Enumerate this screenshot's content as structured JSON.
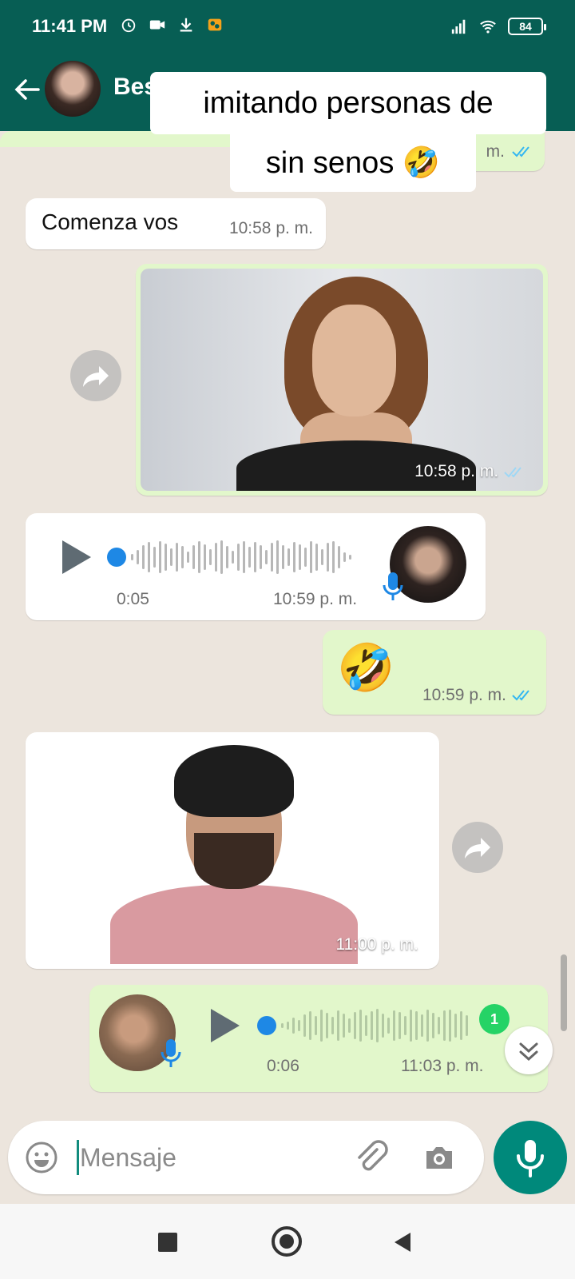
{
  "status_bar": {
    "time": "11:41 PM",
    "battery": "84"
  },
  "header": {
    "contact_name": "Bes"
  },
  "caption": {
    "line1": "imitando personas de",
    "line2": "sin senos 🤣"
  },
  "messages": [
    {
      "id": "partial",
      "direction": "out",
      "time": "m."
    },
    {
      "id": "text1",
      "direction": "in",
      "text": "Comenza vos",
      "time": "10:58 p. m."
    },
    {
      "id": "image1",
      "direction": "out",
      "time": "10:58 p. m."
    },
    {
      "id": "voice1",
      "direction": "in",
      "duration": "0:05",
      "time": "10:59 p. m."
    },
    {
      "id": "emoji1",
      "direction": "out",
      "text": "🤣",
      "time": "10:59 p. m."
    },
    {
      "id": "image2",
      "direction": "in",
      "time": "11:00 p. m."
    },
    {
      "id": "voice2",
      "direction": "out",
      "duration": "0:06",
      "time": "11:03 p. m.",
      "unread_badge": "1"
    }
  ],
  "input": {
    "placeholder": "Mensaje"
  },
  "colors": {
    "header": "#075e54",
    "outgoing_bubble": "#e2f7cb",
    "incoming_bubble": "#ffffff",
    "read_ticks": "#34b7f1",
    "mic_button": "#00897b"
  }
}
